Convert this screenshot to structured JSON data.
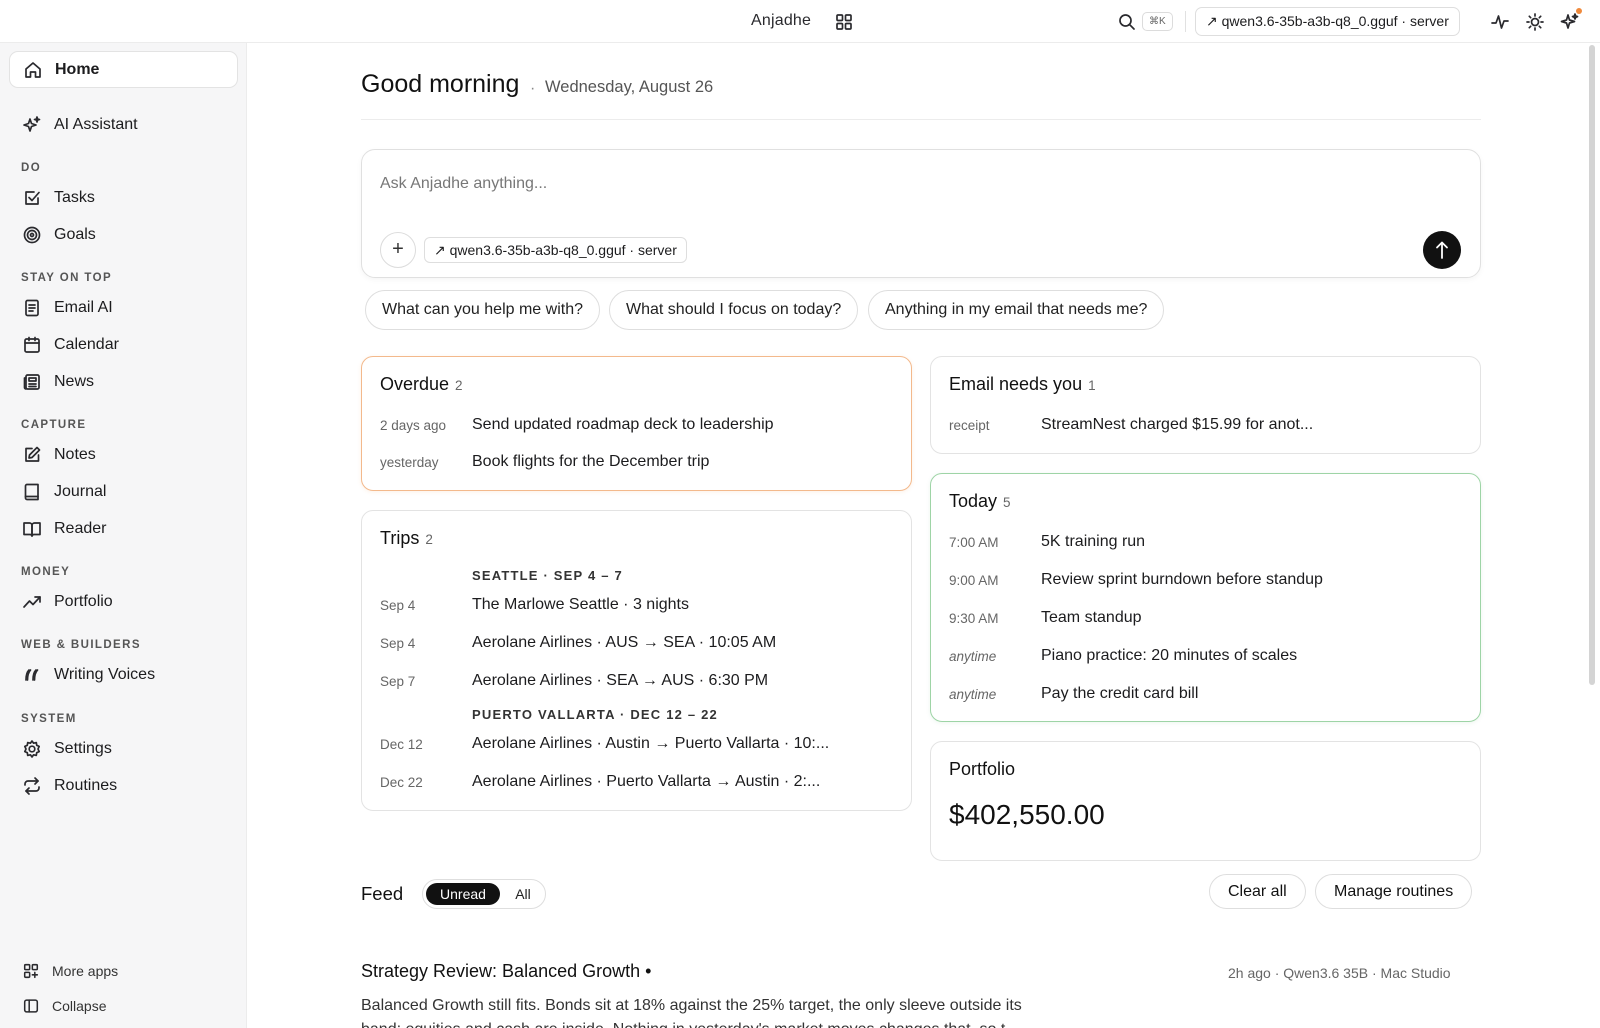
{
  "topbar": {
    "app_title": "Anjadhe",
    "shortcut": "⌘K",
    "model": "↗ qwen3.6-35b-a3b-q8_0.gguf · server"
  },
  "sidebar": {
    "home": "Home",
    "ai_assistant": "AI Assistant",
    "sections": {
      "do": "DO",
      "stay_on_top": "STAY ON TOP",
      "capture": "CAPTURE",
      "money": "MONEY",
      "web_builders": "WEB & BUILDERS",
      "system": "SYSTEM"
    },
    "items": {
      "tasks": "Tasks",
      "goals": "Goals",
      "email_ai": "Email AI",
      "calendar": "Calendar",
      "news": "News",
      "notes": "Notes",
      "journal": "Journal",
      "reader": "Reader",
      "portfolio": "Portfolio",
      "writing_voices": "Writing Voices",
      "settings": "Settings",
      "routines": "Routines"
    },
    "more_apps": "More apps",
    "collapse": "Collapse"
  },
  "greeting": {
    "title": "Good morning",
    "separator": "·",
    "date": "Wednesday, August 26"
  },
  "ask": {
    "placeholder": "Ask Anjadhe anything...",
    "plus": "+",
    "model": "↗ qwen3.6-35b-a3b-q8_0.gguf · server"
  },
  "suggestions": [
    "What can you help me with?",
    "What should I focus on today?",
    "Anything in my email that needs me?"
  ],
  "overdue": {
    "title": "Overdue",
    "count": "2",
    "rows": [
      {
        "meta": "2 days ago",
        "text": "Send updated roadmap deck to leadership"
      },
      {
        "meta": "yesterday",
        "text": "Book flights for the December trip"
      }
    ]
  },
  "email": {
    "title": "Email needs you",
    "count": "1",
    "rows": [
      {
        "meta": "receipt",
        "text": "StreamNest charged $15.99 for anot..."
      }
    ]
  },
  "trips": {
    "title": "Trips",
    "count": "2",
    "groups": [
      {
        "heading": "SEATTLE · SEP 4 – 7",
        "rows": [
          {
            "meta": "Sep 4",
            "text": "The Marlowe Seattle · 3 nights"
          },
          {
            "meta": "Sep 4",
            "text": "Aerolane Airlines · AUS → SEA · 10:05 AM"
          },
          {
            "meta": "Sep 7",
            "text": "Aerolane Airlines · SEA → AUS · 6:30 PM"
          }
        ]
      },
      {
        "heading": "PUERTO VALLARTA · DEC 12 – 22",
        "rows": [
          {
            "meta": "Dec 12",
            "text": "Aerolane Airlines · Austin → Puerto Vallarta · 10:..."
          },
          {
            "meta": "Dec 22",
            "text": "Aerolane Airlines · Puerto Vallarta → Austin · 2:..."
          }
        ]
      }
    ]
  },
  "today": {
    "title": "Today",
    "count": "5",
    "rows": [
      {
        "meta": "7:00 AM",
        "text": "5K training run"
      },
      {
        "meta": "9:00 AM",
        "text": "Review sprint burndown before standup"
      },
      {
        "meta": "9:30 AM",
        "text": "Team standup"
      },
      {
        "meta": "anytime",
        "text": "Piano practice: 20 minutes of scales"
      },
      {
        "meta": "anytime",
        "text": "Pay the credit card bill"
      }
    ]
  },
  "portfolio": {
    "title": "Portfolio",
    "value": "$402,550.00"
  },
  "feed": {
    "title": "Feed",
    "tab_unread": "Unread",
    "tab_all": "All",
    "clear_all": "Clear all",
    "manage_routines": "Manage routines",
    "item": {
      "title": "Strategy Review: Balanced Growth •",
      "meta": "2h ago · Qwen3.6 35B · Mac Studio",
      "body": "Balanced Growth still fits. Bonds sit at 18% against the 25% target, the only sleeve outside its band; equities and cash are inside. Nothing in yesterday's market moves changes that, so t"
    }
  },
  "colors": {
    "accent_overdue": "#f3b98c",
    "accent_today": "#9ed4a6",
    "notification": "#f08a3c"
  }
}
